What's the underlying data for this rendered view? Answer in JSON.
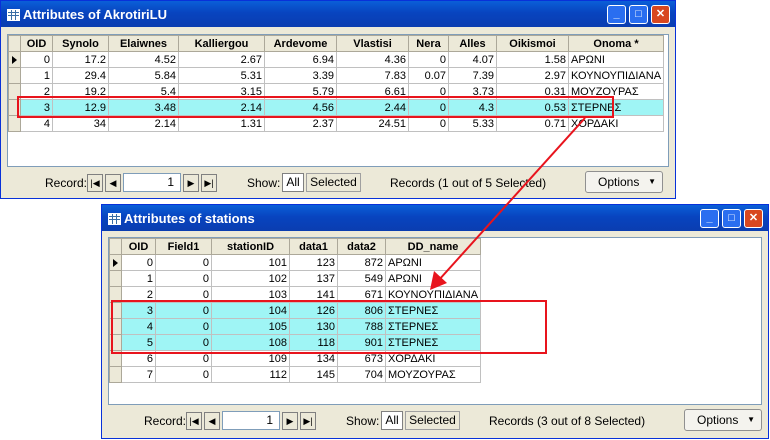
{
  "window1": {
    "title": "Attributes of AkrotiriLU",
    "columns": [
      "OID",
      "Synolo",
      "Elaiwnes",
      "Kalliergou",
      "Ardevome",
      "Vlastisi",
      "Nera",
      "Alles",
      "Oikismoi",
      "Onoma *"
    ],
    "rows": [
      [
        "0",
        "17.2",
        "4.52",
        "2.67",
        "6.94",
        "4.36",
        "0",
        "4.07",
        "1.58",
        "ΑΡΩΝΙ"
      ],
      [
        "1",
        "29.4",
        "5.84",
        "5.31",
        "3.39",
        "7.83",
        "0.07",
        "7.39",
        "2.97",
        "ΚΟΥΝΟΥΠΙΔΙΑΝΑ"
      ],
      [
        "2",
        "19.2",
        "5.4",
        "3.15",
        "5.79",
        "6.61",
        "0",
        "3.73",
        "0.31",
        "ΜΟΥΖΟΥΡΑΣ"
      ],
      [
        "3",
        "12.9",
        "3.48",
        "2.14",
        "4.56",
        "2.44",
        "0",
        "4.3",
        "0.53",
        "ΣΤΕΡΝΕΣ"
      ],
      [
        "4",
        "34",
        "2.14",
        "1.31",
        "2.37",
        "24.51",
        "0",
        "5.33",
        "0.71",
        "ΧΟΡΔΑΚΙ"
      ]
    ],
    "footer": {
      "record_label": "Record:",
      "record_value": "1",
      "show_label": "Show:",
      "all_label": "All",
      "selected_label": "Selected",
      "records_text": "Records (1 out of 5 Selected)",
      "options_label": "Options"
    }
  },
  "window2": {
    "title": "Attributes of stations",
    "columns": [
      "OID",
      "Field1",
      "stationID",
      "data1",
      "data2",
      "DD_name"
    ],
    "rows": [
      [
        "0",
        "0",
        "101",
        "123",
        "872",
        "ΑΡΩΝΙ"
      ],
      [
        "1",
        "0",
        "102",
        "137",
        "549",
        "ΑΡΩΝΙ"
      ],
      [
        "2",
        "0",
        "103",
        "141",
        "671",
        "ΚΟΥΝΟΥΠΙΔΙΑΝΑ"
      ],
      [
        "3",
        "0",
        "104",
        "126",
        "806",
        "ΣΤΕΡΝΕΣ"
      ],
      [
        "4",
        "0",
        "105",
        "130",
        "788",
        "ΣΤΕΡΝΕΣ"
      ],
      [
        "5",
        "0",
        "108",
        "118",
        "901",
        "ΣΤΕΡΝΕΣ"
      ],
      [
        "6",
        "0",
        "109",
        "134",
        "673",
        "ΧΟΡΔΑΚΙ"
      ],
      [
        "7",
        "0",
        "112",
        "145",
        "704",
        "ΜΟΥΖΟΥΡΑΣ"
      ]
    ],
    "footer": {
      "record_label": "Record:",
      "record_value": "1",
      "show_label": "Show:",
      "all_label": "All",
      "selected_label": "Selected",
      "records_text": "Records (3 out of 8 Selected)",
      "options_label": "Options"
    }
  },
  "colors": {
    "highlight_row": "#9ff5f5",
    "annotation_red": "#e8141d",
    "titlebar_blue": "#0a5fd8"
  },
  "icons": [
    "table-icon",
    "minimize-icon",
    "maximize-icon",
    "close-icon",
    "first-record-icon",
    "prev-record-icon",
    "next-record-icon",
    "last-record-icon",
    "dropdown-arrow-icon",
    "current-row-arrow-icon"
  ]
}
